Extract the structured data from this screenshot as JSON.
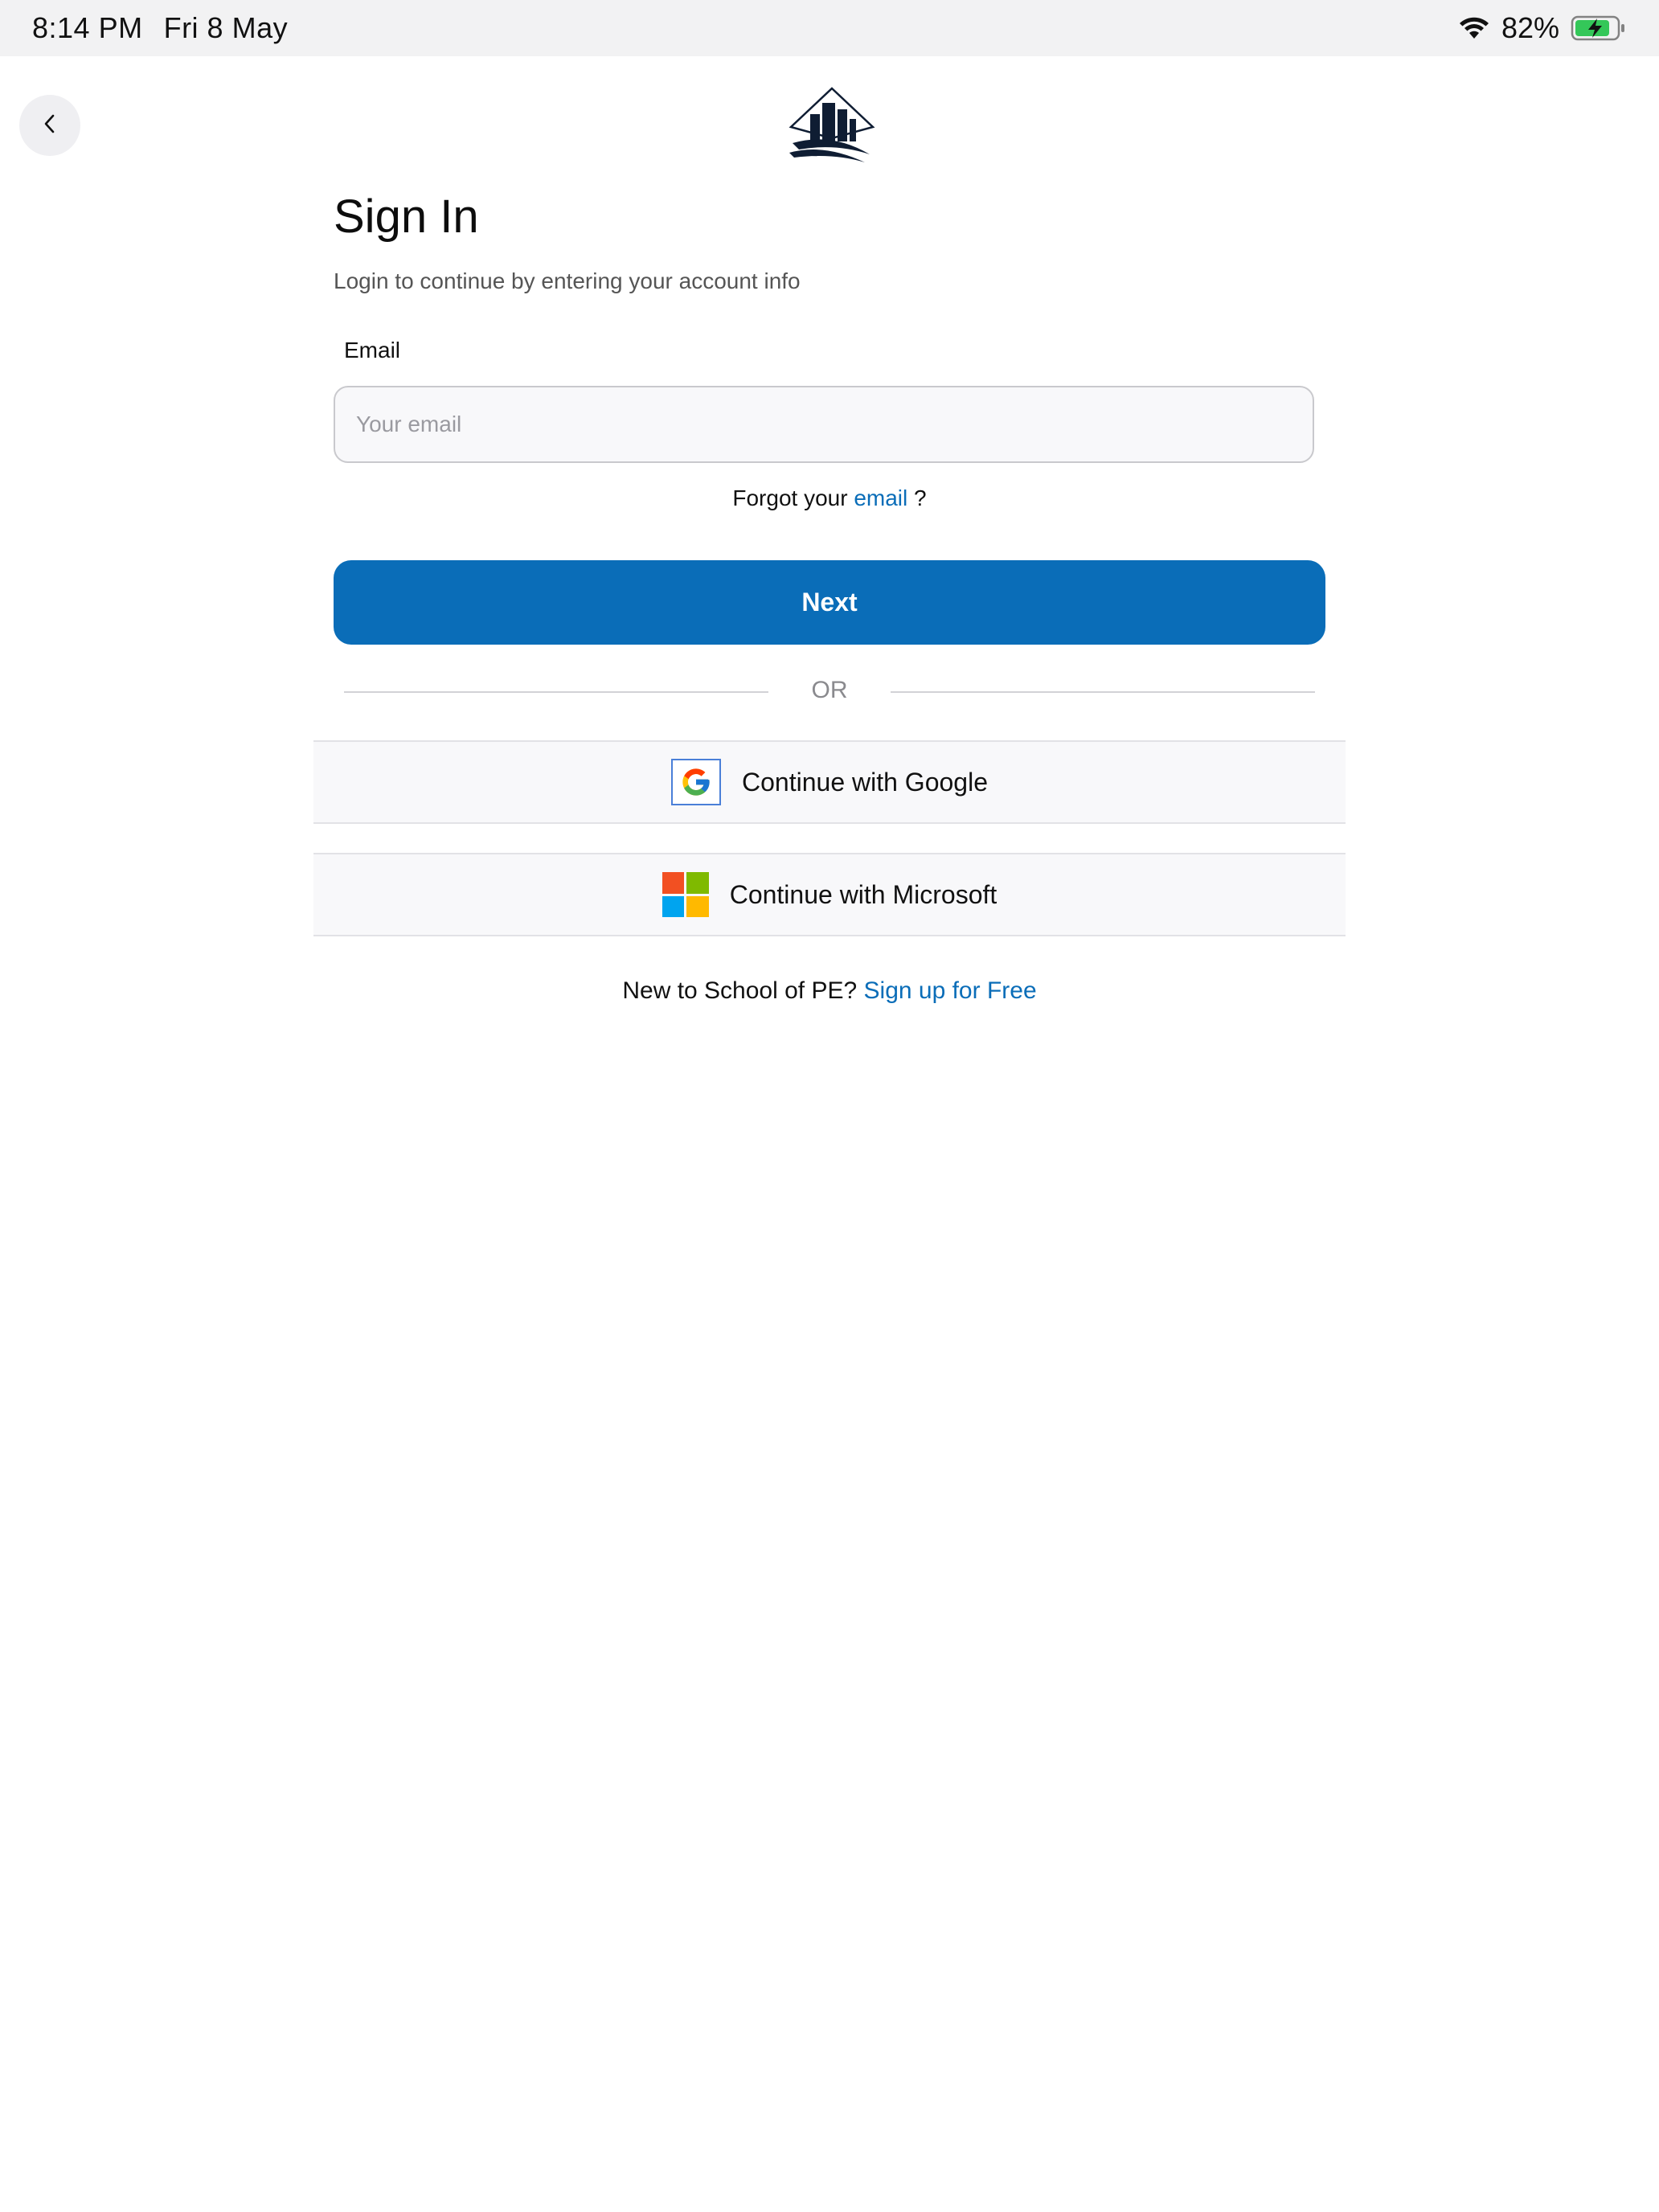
{
  "status_bar": {
    "time": "8:14 PM",
    "date": "Fri 8 May",
    "battery_percent": "82%",
    "battery_level": 0.82,
    "wifi_icon": "wifi-icon",
    "battery_icon": "battery-charging-icon"
  },
  "nav": {
    "back_icon": "chevron-left-icon"
  },
  "logo": {
    "icon": "buildings-logo"
  },
  "form": {
    "title": "Sign In",
    "subtitle": "Login to continue by entering your account info",
    "email_label": "Email",
    "email_placeholder": "Your email",
    "email_value": "",
    "forgot_prefix": "Forgot your",
    "forgot_link": "email",
    "forgot_suffix": "?",
    "next_label": "Next",
    "divider_text": "OR"
  },
  "sso": {
    "google_label": "Continue with Google",
    "microsoft_label": "Continue with Microsoft"
  },
  "signup": {
    "prompt": "New to School of PE?",
    "link": "Sign up for Free"
  },
  "colors": {
    "primary": "#0a6db8",
    "status_bar_bg": "#f2f2f3",
    "battery_green": "#34c759"
  }
}
